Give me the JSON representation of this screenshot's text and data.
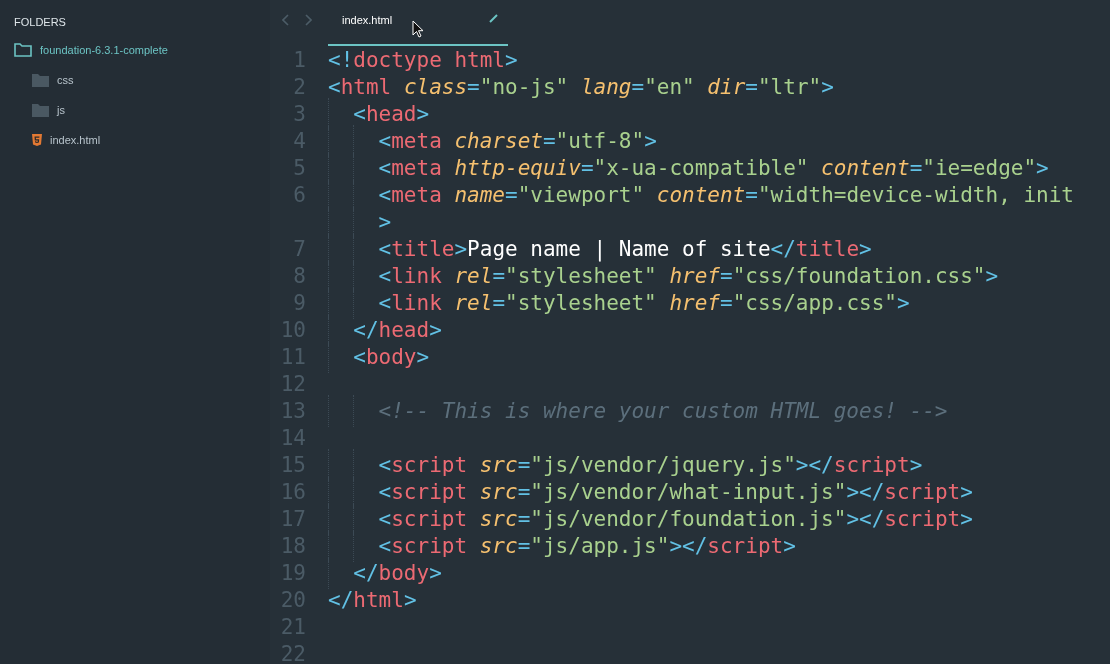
{
  "sidebar": {
    "title": "FOLDERS",
    "tree": [
      {
        "label": "foundation-6.3.1-complete",
        "kind": "folder",
        "expanded": true,
        "children": [
          {
            "label": "css",
            "kind": "folder",
            "expanded": false
          },
          {
            "label": "js",
            "kind": "folder",
            "expanded": false
          },
          {
            "label": "index.html",
            "kind": "html"
          }
        ]
      }
    ]
  },
  "tabs": [
    {
      "label": "index.html",
      "selected": true
    }
  ],
  "editor": {
    "lines": [
      {
        "number": "1",
        "tokens": [
          {
            "text": "<!",
            "kind": "punct"
          },
          {
            "text": "doctype html",
            "kind": "tag"
          },
          {
            "text": ">",
            "kind": "punct"
          }
        ]
      },
      {
        "number": "2",
        "tokens": [
          {
            "text": "<",
            "kind": "punct"
          },
          {
            "text": "html",
            "kind": "tag"
          },
          {
            "text": " class",
            "kind": "attr"
          },
          {
            "text": "=",
            "kind": "punct"
          },
          {
            "text": "\"no-js\"",
            "kind": "string"
          },
          {
            "text": " lang",
            "kind": "attr"
          },
          {
            "text": "=",
            "kind": "punct"
          },
          {
            "text": "\"en\"",
            "kind": "string"
          },
          {
            "text": " dir",
            "kind": "attr"
          },
          {
            "text": "=",
            "kind": "punct"
          },
          {
            "text": "\"ltr\"",
            "kind": "string"
          },
          {
            "text": ">",
            "kind": "punct"
          }
        ]
      },
      {
        "number": "3",
        "tokens": [
          {
            "text": "  <",
            "kind": "punct"
          },
          {
            "text": "head",
            "kind": "tag"
          },
          {
            "text": ">",
            "kind": "punct"
          }
        ]
      },
      {
        "number": "4",
        "tokens": [
          {
            "text": "    <",
            "kind": "punct"
          },
          {
            "text": "meta",
            "kind": "tag"
          },
          {
            "text": " charset",
            "kind": "attr"
          },
          {
            "text": "=",
            "kind": "punct"
          },
          {
            "text": "\"utf-8\"",
            "kind": "string"
          },
          {
            "text": ">",
            "kind": "punct"
          }
        ]
      },
      {
        "number": "5",
        "tokens": [
          {
            "text": "    <",
            "kind": "punct"
          },
          {
            "text": "meta",
            "kind": "tag"
          },
          {
            "text": " http-equiv",
            "kind": "attr"
          },
          {
            "text": "=",
            "kind": "punct"
          },
          {
            "text": "\"x-ua-compatible\"",
            "kind": "string"
          },
          {
            "text": " content",
            "kind": "attr"
          },
          {
            "text": "=",
            "kind": "punct"
          },
          {
            "text": "\"ie=edge\"",
            "kind": "string"
          },
          {
            "text": ">",
            "kind": "punct"
          }
        ]
      },
      {
        "number": "6",
        "tokens": [
          {
            "text": "    <",
            "kind": "punct"
          },
          {
            "text": "meta",
            "kind": "tag"
          },
          {
            "text": " name",
            "kind": "attr"
          },
          {
            "text": "=",
            "kind": "punct"
          },
          {
            "text": "\"viewport\"",
            "kind": "string"
          },
          {
            "text": " content",
            "kind": "attr"
          },
          {
            "text": "=",
            "kind": "punct"
          },
          {
            "text": "\"width=device-width, init",
            "kind": "string"
          }
        ]
      },
      {
        "tokens": [
          {
            "text": "    >",
            "kind": "punct"
          }
        ]
      },
      {
        "number": "7",
        "tokens": [
          {
            "text": "    <",
            "kind": "punct"
          },
          {
            "text": "title",
            "kind": "tag"
          },
          {
            "text": ">",
            "kind": "punct"
          },
          {
            "text": "Page name | Name of site",
            "kind": "text"
          },
          {
            "text": "</",
            "kind": "punct"
          },
          {
            "text": "title",
            "kind": "tag"
          },
          {
            "text": ">",
            "kind": "punct"
          }
        ]
      },
      {
        "number": "8",
        "tokens": [
          {
            "text": "    <",
            "kind": "punct"
          },
          {
            "text": "link",
            "kind": "tag"
          },
          {
            "text": " rel",
            "kind": "attr"
          },
          {
            "text": "=",
            "kind": "punct"
          },
          {
            "text": "\"stylesheet\"",
            "kind": "string"
          },
          {
            "text": " href",
            "kind": "attr"
          },
          {
            "text": "=",
            "kind": "punct"
          },
          {
            "text": "\"css/foundation.css\"",
            "kind": "string"
          },
          {
            "text": ">",
            "kind": "punct"
          }
        ]
      },
      {
        "number": "9",
        "tokens": [
          {
            "text": "    <",
            "kind": "punct"
          },
          {
            "text": "link",
            "kind": "tag"
          },
          {
            "text": " rel",
            "kind": "attr"
          },
          {
            "text": "=",
            "kind": "punct"
          },
          {
            "text": "\"stylesheet\"",
            "kind": "string"
          },
          {
            "text": " href",
            "kind": "attr"
          },
          {
            "text": "=",
            "kind": "punct"
          },
          {
            "text": "\"css/app.css\"",
            "kind": "string"
          },
          {
            "text": ">",
            "kind": "punct"
          }
        ]
      },
      {
        "number": "10",
        "tokens": [
          {
            "text": "  </",
            "kind": "punct"
          },
          {
            "text": "head",
            "kind": "tag"
          },
          {
            "text": ">",
            "kind": "punct"
          }
        ]
      },
      {
        "number": "11",
        "tokens": [
          {
            "text": "  <",
            "kind": "punct"
          },
          {
            "text": "body",
            "kind": "tag"
          },
          {
            "text": ">",
            "kind": "punct"
          }
        ]
      },
      {
        "number": "12"
      },
      {
        "number": "13",
        "tokens": [
          {
            "text": "    <!-- This is where your custom HTML goes! -->",
            "kind": "comment"
          }
        ]
      },
      {
        "number": "14"
      },
      {
        "number": "15",
        "tokens": [
          {
            "text": "    <",
            "kind": "punct"
          },
          {
            "text": "script",
            "kind": "tag"
          },
          {
            "text": " src",
            "kind": "attr"
          },
          {
            "text": "=",
            "kind": "punct"
          },
          {
            "text": "\"js/vendor/jquery.js\"",
            "kind": "string"
          },
          {
            "text": "></",
            "kind": "punct"
          },
          {
            "text": "script",
            "kind": "tag"
          },
          {
            "text": ">",
            "kind": "punct"
          }
        ]
      },
      {
        "number": "16",
        "tokens": [
          {
            "text": "    <",
            "kind": "punct"
          },
          {
            "text": "script",
            "kind": "tag"
          },
          {
            "text": " src",
            "kind": "attr"
          },
          {
            "text": "=",
            "kind": "punct"
          },
          {
            "text": "\"js/vendor/what-input.js\"",
            "kind": "string"
          },
          {
            "text": "></",
            "kind": "punct"
          },
          {
            "text": "script",
            "kind": "tag"
          },
          {
            "text": ">",
            "kind": "punct"
          }
        ]
      },
      {
        "number": "17",
        "tokens": [
          {
            "text": "    <",
            "kind": "punct"
          },
          {
            "text": "script",
            "kind": "tag"
          },
          {
            "text": " src",
            "kind": "attr"
          },
          {
            "text": "=",
            "kind": "punct"
          },
          {
            "text": "\"js/vendor/foundation.js\"",
            "kind": "string"
          },
          {
            "text": "></",
            "kind": "punct"
          },
          {
            "text": "script",
            "kind": "tag"
          },
          {
            "text": ">",
            "kind": "punct"
          }
        ]
      },
      {
        "number": "18",
        "tokens": [
          {
            "text": "    <",
            "kind": "punct"
          },
          {
            "text": "script",
            "kind": "tag"
          },
          {
            "text": " src",
            "kind": "attr"
          },
          {
            "text": "=",
            "kind": "punct"
          },
          {
            "text": "\"js/app.js\"",
            "kind": "string"
          },
          {
            "text": "></",
            "kind": "punct"
          },
          {
            "text": "script",
            "kind": "tag"
          },
          {
            "text": ">",
            "kind": "punct"
          }
        ]
      },
      {
        "number": "19",
        "tokens": [
          {
            "text": "  </",
            "kind": "punct"
          },
          {
            "text": "body",
            "kind": "tag"
          },
          {
            "text": ">",
            "kind": "punct"
          }
        ]
      },
      {
        "number": "20",
        "tokens": [
          {
            "text": "</",
            "kind": "punct"
          },
          {
            "text": "html",
            "kind": "tag"
          },
          {
            "text": ">",
            "kind": "punct"
          }
        ]
      },
      {
        "number": "21"
      },
      {
        "number": "22"
      }
    ]
  }
}
